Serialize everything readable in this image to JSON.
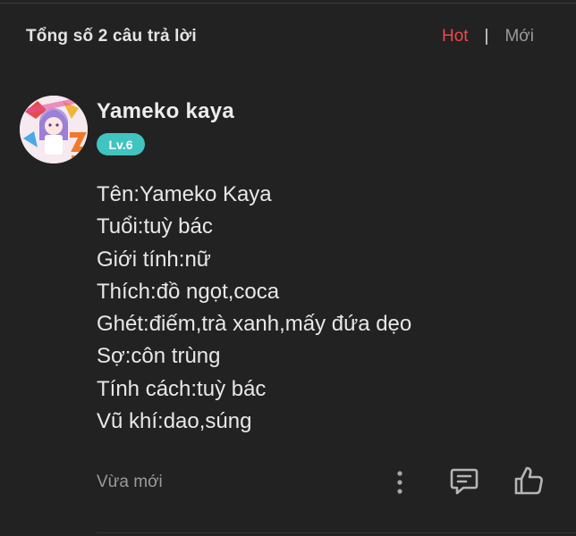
{
  "header": {
    "total_answers": "Tổng số 2 câu trả lời",
    "sort_hot": "Hot",
    "separator": "|",
    "sort_new": "Mới"
  },
  "answer": {
    "username": "Yameko kaya",
    "level": "Lv.6",
    "content_lines": [
      "Tên:Yameko Kaya",
      "Tuổi:tuỳ bác",
      "Giới tính:nữ",
      "Thích:đồ ngọt,coca",
      "Ghét:điếm,trà xanh,mấy đứa dẹo",
      "Sợ:côn trùng",
      "Tính cách:tuỳ bác",
      "Vũ khí:dao,súng"
    ],
    "time": "Vừa mới",
    "icons": {
      "more": "more-vertical-icon",
      "reply": "comment-icon",
      "like": "thumbs-up-icon"
    }
  },
  "colors": {
    "background": "#222222",
    "hot_accent": "#f04848",
    "level_badge": "#3fc4c0"
  }
}
